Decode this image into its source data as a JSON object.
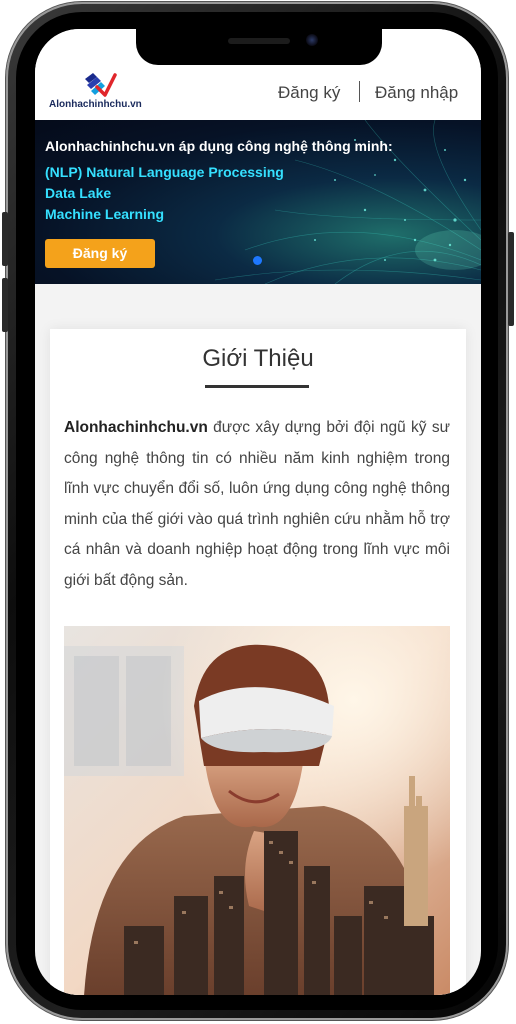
{
  "header": {
    "logo_text": "Alonhachinhchu.vn",
    "register_label": "Đăng ký",
    "login_label": "Đăng nhập"
  },
  "banner": {
    "title": "Alonhachinhchu.vn áp dụng công nghệ thông minh:",
    "lines": [
      "(NLP) Natural Language Processing",
      "Data Lake",
      "Machine Learning"
    ],
    "cta_label": "Đăng ký",
    "colors": {
      "cta": "#f4a21b",
      "highlight": "#35e0ff",
      "dot": "#1e78ff"
    }
  },
  "intro_section": {
    "title": "Giới Thiệu",
    "brand": "Alonhachinhchu.vn",
    "body": " được xây dựng bởi đội ngũ kỹ sư công nghệ thông tin có nhiều năm kinh nghiệm trong lĩnh vực chuyển đổi số, luôn ứng dụng công nghệ thông minh của thế giới vào quá trình nghiên cứu nhằm hỗ trợ cá nhân và doanh nghiệp hoạt động trong lĩnh vực môi giới bất động sản."
  }
}
